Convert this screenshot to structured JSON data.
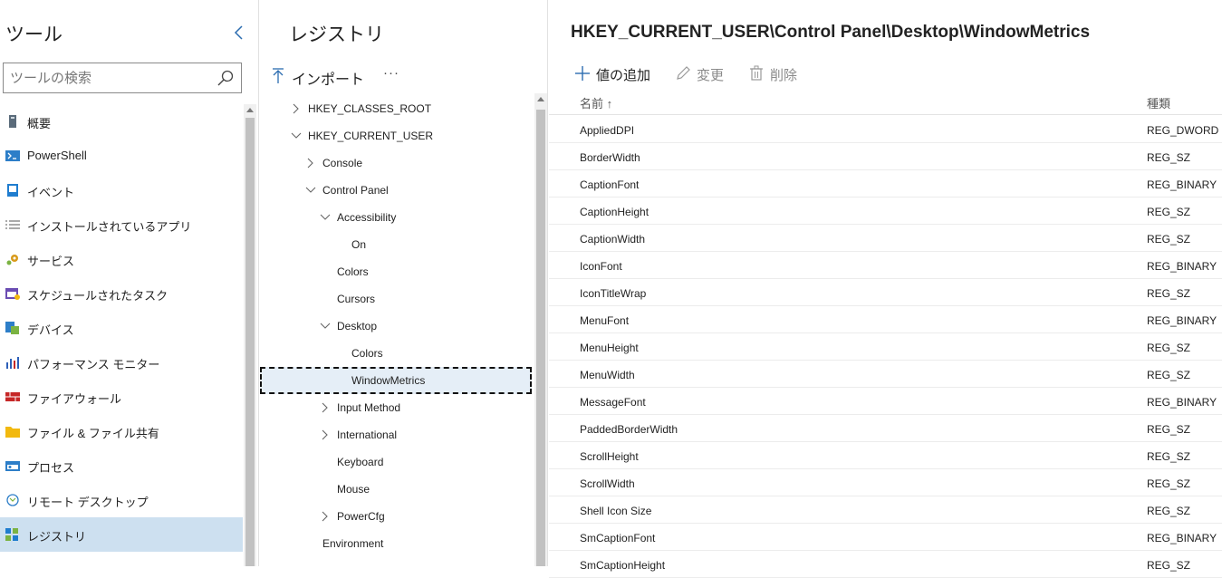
{
  "tools": {
    "title": "ツール",
    "search_placeholder": "ツールの検索",
    "items": [
      {
        "label": "概要",
        "icon": "overview-icon",
        "color": "#5a6b7a"
      },
      {
        "label": "PowerShell",
        "icon": "powershell-icon",
        "color": "#2d7ec8"
      },
      {
        "label": "イベント",
        "icon": "event-icon",
        "color": "#1f7dcf"
      },
      {
        "label": "インストールされているアプリ",
        "icon": "list-icon",
        "color": "#555555"
      },
      {
        "label": "サービス",
        "icon": "gear-icon",
        "color": "#d89a1a"
      },
      {
        "label": "スケジュールされたタスク",
        "icon": "calendar-icon",
        "color": "#6b4db3"
      },
      {
        "label": "デバイス",
        "icon": "device-icon",
        "color": "#2d7ec8"
      },
      {
        "label": "パフォーマンス モニター",
        "icon": "chart-icon",
        "color": "#2d5fb8"
      },
      {
        "label": "ファイアウォール",
        "icon": "firewall-icon",
        "color": "#c62828"
      },
      {
        "label": "ファイル & ファイル共有",
        "icon": "folder-icon",
        "color": "#f2b90f"
      },
      {
        "label": "プロセス",
        "icon": "process-icon",
        "color": "#2d7ec8"
      },
      {
        "label": "リモート デスクトップ",
        "icon": "remote-desktop-icon",
        "color": "#2d7ec8"
      },
      {
        "label": "レジストリ",
        "icon": "registry-icon",
        "color": "#1f7dcf",
        "selected": true
      }
    ]
  },
  "registry": {
    "title": "レジストリ",
    "import_label": "インポート",
    "more_label": "···",
    "tree": [
      {
        "label": "HKEY_CLASSES_ROOT",
        "level": 0,
        "chevron": "right"
      },
      {
        "label": "HKEY_CURRENT_USER",
        "level": 0,
        "chevron": "down"
      },
      {
        "label": "Console",
        "level": 1,
        "chevron": "right"
      },
      {
        "label": "Control Panel",
        "level": 1,
        "chevron": "down"
      },
      {
        "label": "Accessibility",
        "level": 2,
        "chevron": "down"
      },
      {
        "label": "On",
        "level": 3,
        "chevron": "none"
      },
      {
        "label": "Colors",
        "level": 2,
        "chevron": "none"
      },
      {
        "label": "Cursors",
        "level": 2,
        "chevron": "none"
      },
      {
        "label": "Desktop",
        "level": 2,
        "chevron": "down"
      },
      {
        "label": "Colors",
        "level": 3,
        "chevron": "none"
      },
      {
        "label": "WindowMetrics",
        "level": 3,
        "chevron": "none",
        "selected": true
      },
      {
        "label": "Input Method",
        "level": 2,
        "chevron": "right"
      },
      {
        "label": "International",
        "level": 2,
        "chevron": "right"
      },
      {
        "label": "Keyboard",
        "level": 2,
        "chevron": "none"
      },
      {
        "label": "Mouse",
        "level": 2,
        "chevron": "none"
      },
      {
        "label": "PowerCfg",
        "level": 2,
        "chevron": "right"
      },
      {
        "label": "Environment",
        "level": 1,
        "chevron": "none"
      }
    ]
  },
  "values": {
    "path": "HKEY_CURRENT_USER\\Control Panel\\Desktop\\WindowMetrics",
    "add_label": "値の追加",
    "edit_label": "変更",
    "delete_label": "削除",
    "col_name": "名前 ↑",
    "col_type": "種類",
    "rows": [
      {
        "name": "AppliedDPI",
        "type": "REG_DWORD"
      },
      {
        "name": "BorderWidth",
        "type": "REG_SZ"
      },
      {
        "name": "CaptionFont",
        "type": "REG_BINARY"
      },
      {
        "name": "CaptionHeight",
        "type": "REG_SZ"
      },
      {
        "name": "CaptionWidth",
        "type": "REG_SZ"
      },
      {
        "name": "IconFont",
        "type": "REG_BINARY"
      },
      {
        "name": "IconTitleWrap",
        "type": "REG_SZ"
      },
      {
        "name": "MenuFont",
        "type": "REG_BINARY"
      },
      {
        "name": "MenuHeight",
        "type": "REG_SZ"
      },
      {
        "name": "MenuWidth",
        "type": "REG_SZ"
      },
      {
        "name": "MessageFont",
        "type": "REG_BINARY"
      },
      {
        "name": "PaddedBorderWidth",
        "type": "REG_SZ"
      },
      {
        "name": "ScrollHeight",
        "type": "REG_SZ"
      },
      {
        "name": "ScrollWidth",
        "type": "REG_SZ"
      },
      {
        "name": "Shell Icon Size",
        "type": "REG_SZ"
      },
      {
        "name": "SmCaptionFont",
        "type": "REG_BINARY"
      },
      {
        "name": "SmCaptionHeight",
        "type": "REG_SZ"
      }
    ]
  }
}
